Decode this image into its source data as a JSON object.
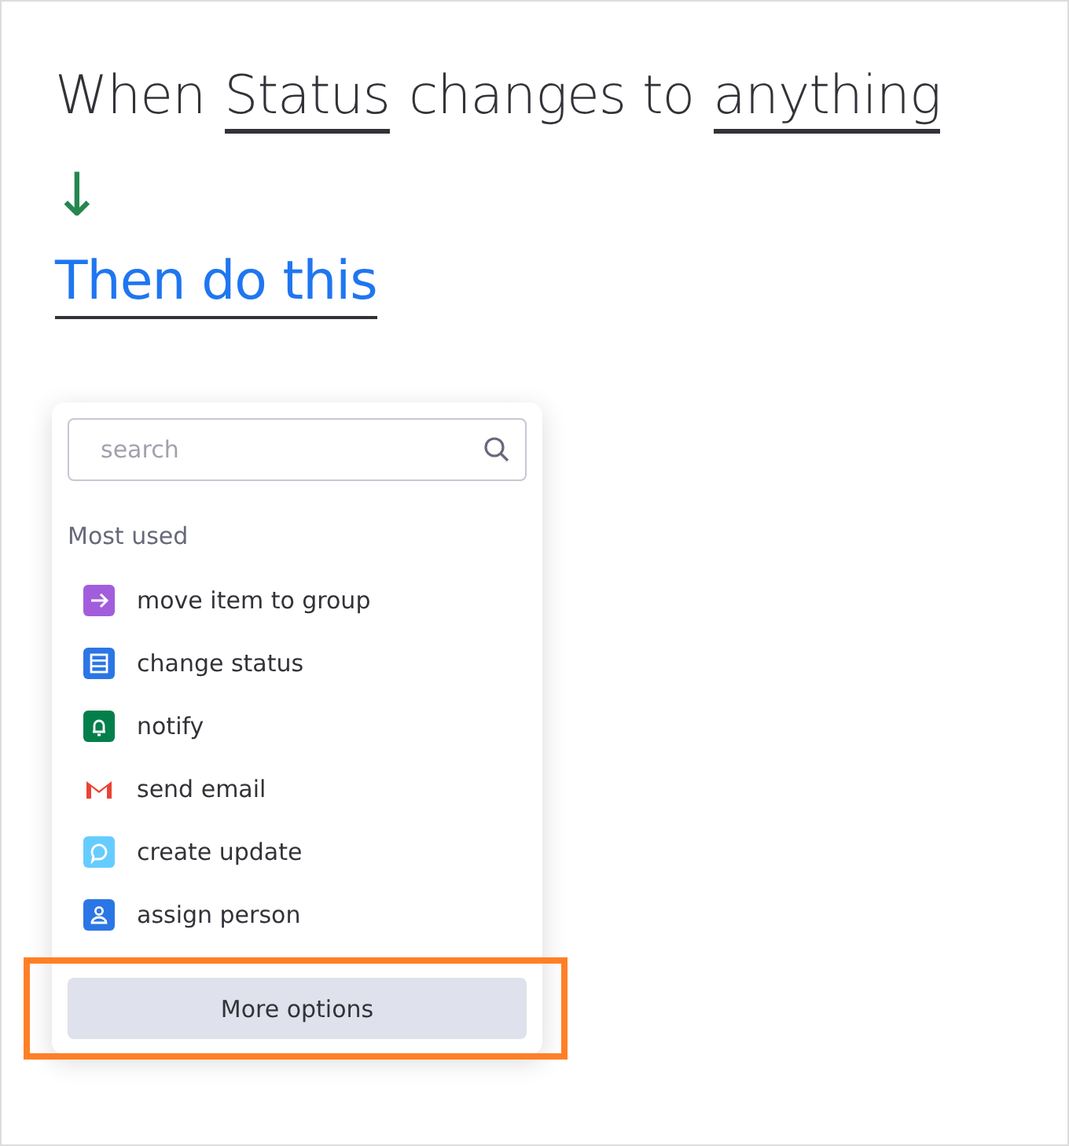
{
  "trigger": [
    {
      "kind": "text",
      "text": "When"
    },
    {
      "kind": "field",
      "text": "Status"
    },
    {
      "kind": "text",
      "text": "changes to"
    },
    {
      "kind": "field",
      "text": "anything"
    }
  ],
  "arrow": "↓",
  "action_link": "Then do this",
  "menu": {
    "search": {
      "placeholder": "search"
    },
    "section": "Most used",
    "items": [
      {
        "label": "move item to group",
        "kind": "arrow",
        "color": "#a25ddc"
      },
      {
        "label": "change status",
        "kind": "status",
        "color": "#2b76e5"
      },
      {
        "label": "notify",
        "kind": "bell",
        "color": "#037f4c"
      },
      {
        "label": "send email",
        "kind": "mail",
        "color": "#ea4335"
      },
      {
        "label": "create update",
        "kind": "chat",
        "color": "#66ccff"
      },
      {
        "label": "assign person",
        "kind": "person",
        "color": "#2b76e5"
      }
    ],
    "more_button": {
      "label": "More options",
      "highlighted": true
    }
  }
}
